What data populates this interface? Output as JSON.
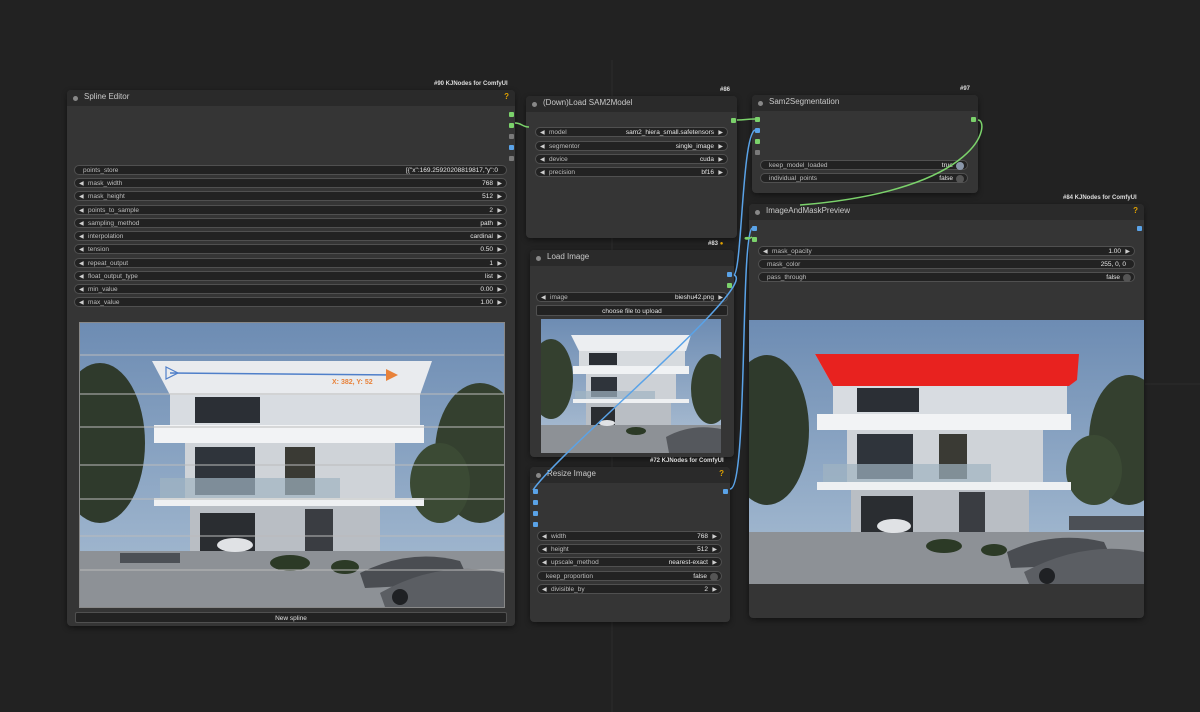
{
  "nodes": {
    "spline_editor": {
      "title": "Spline Editor",
      "badge": "#90 KJNodes for ComfyUI",
      "help": "?",
      "widgets": [
        {
          "label": "points_store",
          "value": "[{\"x\":169.25920208819817,\"y\":0"
        },
        {
          "label": "mask_width",
          "value": "768"
        },
        {
          "label": "mask_height",
          "value": "512"
        },
        {
          "label": "points_to_sample",
          "value": "2"
        },
        {
          "label": "sampling_method",
          "value": "path"
        },
        {
          "label": "interpolation",
          "value": "cardinal"
        },
        {
          "label": "tension",
          "value": "0.50"
        },
        {
          "label": "repeat_output",
          "value": "1"
        },
        {
          "label": "float_output_type",
          "value": "list"
        },
        {
          "label": "min_value",
          "value": "0.00"
        },
        {
          "label": "max_value",
          "value": "1.00"
        }
      ],
      "coord_label": "X: 382, Y: 52",
      "new_spline_button": "New spline"
    },
    "load_sam2": {
      "title": "(Down)Load SAM2Model",
      "badge": "#86",
      "widgets": [
        {
          "label": "model",
          "value": "sam2_hiera_small.safetensors"
        },
        {
          "label": "segmentor",
          "value": "single_image"
        },
        {
          "label": "device",
          "value": "cuda"
        },
        {
          "label": "precision",
          "value": "bf16"
        }
      ]
    },
    "sam2_segmentation": {
      "title": "Sam2Segmentation",
      "badge": "#97",
      "widgets": [
        {
          "label": "keep_model_loaded",
          "value": "true"
        },
        {
          "label": "individual_points",
          "value": "false"
        }
      ]
    },
    "load_image": {
      "title": "Load Image",
      "badge": "#83",
      "widgets": [
        {
          "label": "image",
          "value": "bieshu42.png"
        }
      ],
      "upload_button": "choose file to upload"
    },
    "resize_image": {
      "title": "Resize Image",
      "badge": "#72 KJNodes for ComfyUI",
      "help": "?",
      "widgets": [
        {
          "label": "width",
          "value": "768"
        },
        {
          "label": "height",
          "value": "512"
        },
        {
          "label": "upscale_method",
          "value": "nearest-exact"
        },
        {
          "label": "keep_proportion",
          "value": "false"
        },
        {
          "label": "divisible_by",
          "value": "2"
        }
      ]
    },
    "image_mask_preview": {
      "title": "ImageAndMaskPreview",
      "badge": "#84 KJNodes for ComfyUI",
      "help": "?",
      "widgets": [
        {
          "label": "mask_opacity",
          "value": "1.00"
        },
        {
          "label": "mask_color",
          "value": "255, 0, 0"
        },
        {
          "label": "pass_through",
          "value": "false"
        }
      ]
    }
  },
  "colors": {
    "background": "#222222",
    "node_body": "#353535",
    "node_header": "#2a2a2a",
    "image_link": "#5aa3e8",
    "model_link": "#7bd26b",
    "mask_overlay": "#e8221f",
    "spline_line": "#4f7fc9",
    "spline_end": "#e8823a"
  },
  "icons": {
    "widget_decrement": "◀",
    "widget_increment": "▶",
    "node_collapse": "node-dot-icon"
  }
}
